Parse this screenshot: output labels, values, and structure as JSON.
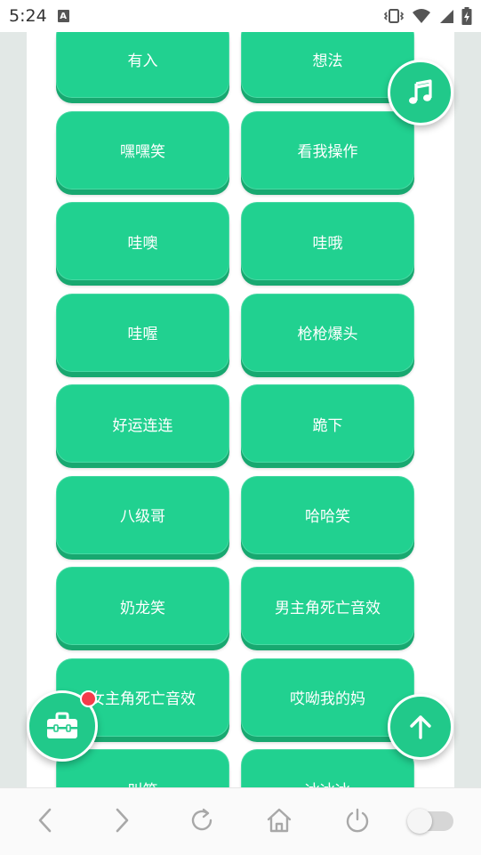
{
  "status_bar": {
    "time": "5:24",
    "notification_icon": "a-letter-icon",
    "icons": [
      "vibrate-icon",
      "wifi-icon",
      "signal-icon",
      "battery-charging-icon"
    ]
  },
  "sounds": [
    {
      "label": "有入"
    },
    {
      "label": "想法"
    },
    {
      "label": "嘿嘿笑"
    },
    {
      "label": "看我操作"
    },
    {
      "label": "哇噢"
    },
    {
      "label": "哇哦"
    },
    {
      "label": "哇喔"
    },
    {
      "label": "枪枪爆头"
    },
    {
      "label": "好运连连"
    },
    {
      "label": "跪下"
    },
    {
      "label": "八级哥"
    },
    {
      "label": "哈哈笑"
    },
    {
      "label": "奶龙笑"
    },
    {
      "label": "男主角死亡音效"
    },
    {
      "label": "女主角死亡音效"
    },
    {
      "label": "哎呦我的妈"
    },
    {
      "label": "叫笑"
    },
    {
      "label": "冰冰冰"
    }
  ],
  "floating": {
    "music": "music-note-icon",
    "toolbox": "toolbox-icon",
    "scroll_top": "arrow-up-icon"
  },
  "bottom_nav": {
    "icons": [
      "back-icon",
      "forward-icon",
      "refresh-icon",
      "home-icon",
      "power-icon",
      "toggle-switch"
    ]
  },
  "colors": {
    "button": "#21d190",
    "button_shadow": "#18a870",
    "fab": "#21c98a",
    "badge": "#f53b4a"
  }
}
